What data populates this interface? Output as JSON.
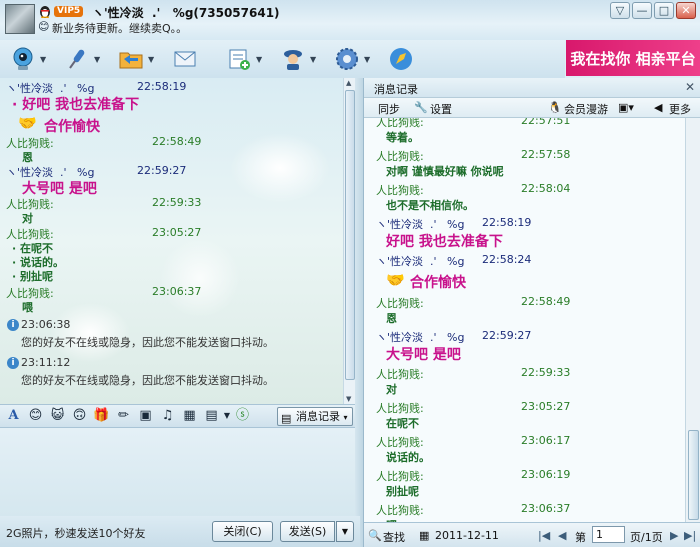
{
  "window": {
    "contact_name": "ヽ'性冷淡  .'   %g(735057641)",
    "vip_label": "VIP5",
    "signature": "新业务待更新。继续卖Q。。",
    "controls": [
      "▽",
      "—",
      "□",
      "✕"
    ]
  },
  "toolbar": {
    "icons": [
      "video-call",
      "voice-call",
      "send-file",
      "send-email",
      "create-group",
      "remote-assist",
      "settings",
      "app-launch"
    ]
  },
  "ad_banner": {
    "text": "我在找你 相亲平台"
  },
  "chat": {
    "messages": [
      {
        "sender": "ヽ'性冷淡  .'   %g",
        "time": "22:58:19",
        "text": "好吧 我也去准备下",
        "style": "pink"
      },
      {
        "sender": "",
        "time": "",
        "text": "合作愉快",
        "style": "pink-emoji"
      },
      {
        "sender": "人比狗贱:",
        "time": "22:58:49",
        "text": "恩",
        "style": "green"
      },
      {
        "sender": "ヽ'性冷淡  .'   %g",
        "time": "22:59:27",
        "text": "大号吧 是吧",
        "style": "pink"
      },
      {
        "sender": "人比狗贱:",
        "time": "22:59:33",
        "text": "对",
        "style": "green"
      },
      {
        "sender": "人比狗贱:",
        "time": "23:05:27",
        "lines": [
          "在呢不",
          "说话的。",
          "别扯呢"
        ],
        "style": "green"
      },
      {
        "sender": "人比狗贱:",
        "time": "23:06:37",
        "text": "喂",
        "style": "green"
      }
    ],
    "system_messages": [
      {
        "time": "23:06:38",
        "text": "您的好友不在线或隐身，因此您不能发送窗口抖动。"
      },
      {
        "time": "23:11:12",
        "text": "您的好友不在线或隐身，因此您不能发送窗口抖动。"
      }
    ]
  },
  "input_toolbar": {
    "icons": [
      "font",
      "emoji",
      "magic-emoji",
      "shake",
      "gift",
      "screenshot",
      "image",
      "music",
      "game",
      "app"
    ],
    "history_label": "消息记录"
  },
  "bottom_bar": {
    "ad_text": "2G照片，秒速发送10个好友",
    "close_label": "关闭(C)",
    "send_label": "发送(S)"
  },
  "history": {
    "title": "消息记录",
    "sync_label": "同步",
    "settings_label": "设置",
    "vip_roam_label": "会员漫游",
    "more_label": "更多",
    "entries": [
      {
        "sender": "人比狗贱:",
        "time": "22:57:51",
        "text": "等着。"
      },
      {
        "sender": "人比狗贱:",
        "time": "22:57:58",
        "text": "对啊 谨慎最好嘛 你说呢"
      },
      {
        "sender": "人比狗贱:",
        "time": "22:58:04",
        "text": "也不是不相信你。"
      },
      {
        "sender": "ヽ'性冷淡  .'   %g",
        "time": "22:58:19",
        "text": "好吧 我也去准备下",
        "style": "pink"
      },
      {
        "sender": "ヽ'性冷淡  .'   %g",
        "time": "22:58:24",
        "text": "合作愉快",
        "style": "pink-emoji"
      },
      {
        "sender": "人比狗贱:",
        "time": "22:58:49",
        "text": "恩"
      },
      {
        "sender": "ヽ'性冷淡  .'   %g",
        "time": "22:59:27",
        "text": "大号吧 是吧",
        "style": "pink"
      },
      {
        "sender": "人比狗贱:",
        "time": "22:59:33",
        "text": "对"
      },
      {
        "sender": "人比狗贱:",
        "time": "23:05:27",
        "text": "在呢不"
      },
      {
        "sender": "人比狗贱:",
        "time": "23:06:17",
        "text": "说话的。"
      },
      {
        "sender": "人比狗贱:",
        "time": "23:06:19",
        "text": "别扯呢"
      },
      {
        "sender": "人比狗贱:",
        "time": "23:06:37",
        "text": "喂"
      }
    ],
    "footer": {
      "search_label": "查找",
      "date": "2011-12-11",
      "page_prefix": "第",
      "page_value": "1",
      "page_suffix": "页/1页"
    }
  },
  "colors": {
    "accent_pink": "#c8128c",
    "sender_green": "#2a7d28",
    "banner": "#d8186c"
  }
}
